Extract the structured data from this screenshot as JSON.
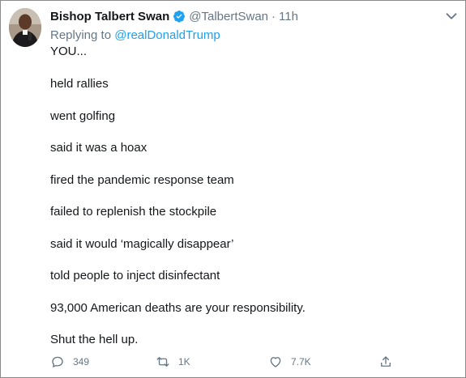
{
  "author": {
    "name": "Bishop Talbert Swan",
    "handle": "@TalbertSwan",
    "separator": "·",
    "time": "11h",
    "verified": true
  },
  "reply": {
    "prefix": "Replying to",
    "to": "@realDonaldTrump"
  },
  "tweet": {
    "lines": [
      "YOU...",
      "held rallies",
      "went golfing",
      "said it was a hoax",
      "fired the pandemic response team",
      "failed to replenish the stockpile",
      "said it would ‘magically disappear’",
      "told people to inject disinfectant",
      "93,000 American deaths are your responsibility.",
      "Shut the hell up."
    ]
  },
  "actions": {
    "reply_count": "349",
    "retweet_count": "1K",
    "like_count": "7.7K",
    "share_label": ""
  },
  "icons": {
    "verified": "verified-badge-icon",
    "more": "chevron-down-icon",
    "reply": "comment-icon",
    "retweet": "retweet-icon",
    "like": "heart-icon",
    "share": "share-icon"
  },
  "colors": {
    "link": "#1da1f2",
    "muted": "#657786",
    "text": "#14171a"
  }
}
